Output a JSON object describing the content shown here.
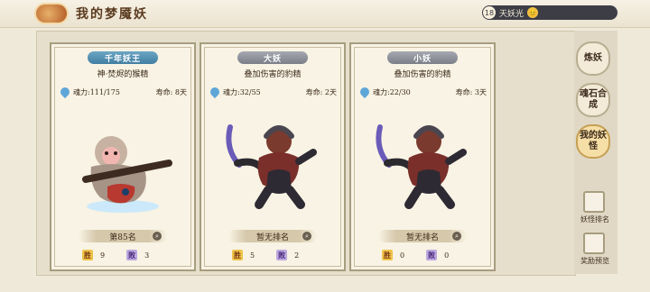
{
  "header": {
    "title": "我的梦魇妖"
  },
  "resource": {
    "count": "18",
    "label": "天妖光",
    "emoji": "😊"
  },
  "cards": [
    {
      "tag": "千年妖王",
      "tag_style": "blue",
      "subtitle": "神·焚烬的猴精",
      "power": "魂力:111/175",
      "life": "寿命: 8天",
      "rank": "第85名",
      "wins": "9",
      "losses": "3"
    },
    {
      "tag": "大妖",
      "tag_style": "gray",
      "subtitle": "叠加伤害的豹精",
      "power": "魂力:32/55",
      "life": "寿命: 2天",
      "rank": "暂无排名",
      "wins": "5",
      "losses": "2"
    },
    {
      "tag": "小妖",
      "tag_style": "gray",
      "subtitle": "叠加伤害的豹精",
      "power": "魂力:22/30",
      "life": "寿命: 3天",
      "rank": "暂无排名",
      "wins": "0",
      "losses": "0"
    }
  ],
  "win_glyph": "胜",
  "lose_glyph": "败",
  "sidebar": {
    "buttons": [
      "炼妖",
      "魂石合成",
      "我的妖怪"
    ],
    "active_index": 2,
    "links": [
      "妖怪排名",
      "奖励预览"
    ]
  },
  "colors": {
    "accent": "#c6a055",
    "tag_blue": "#3f7ea2",
    "tag_gray": "#7b7e88"
  }
}
